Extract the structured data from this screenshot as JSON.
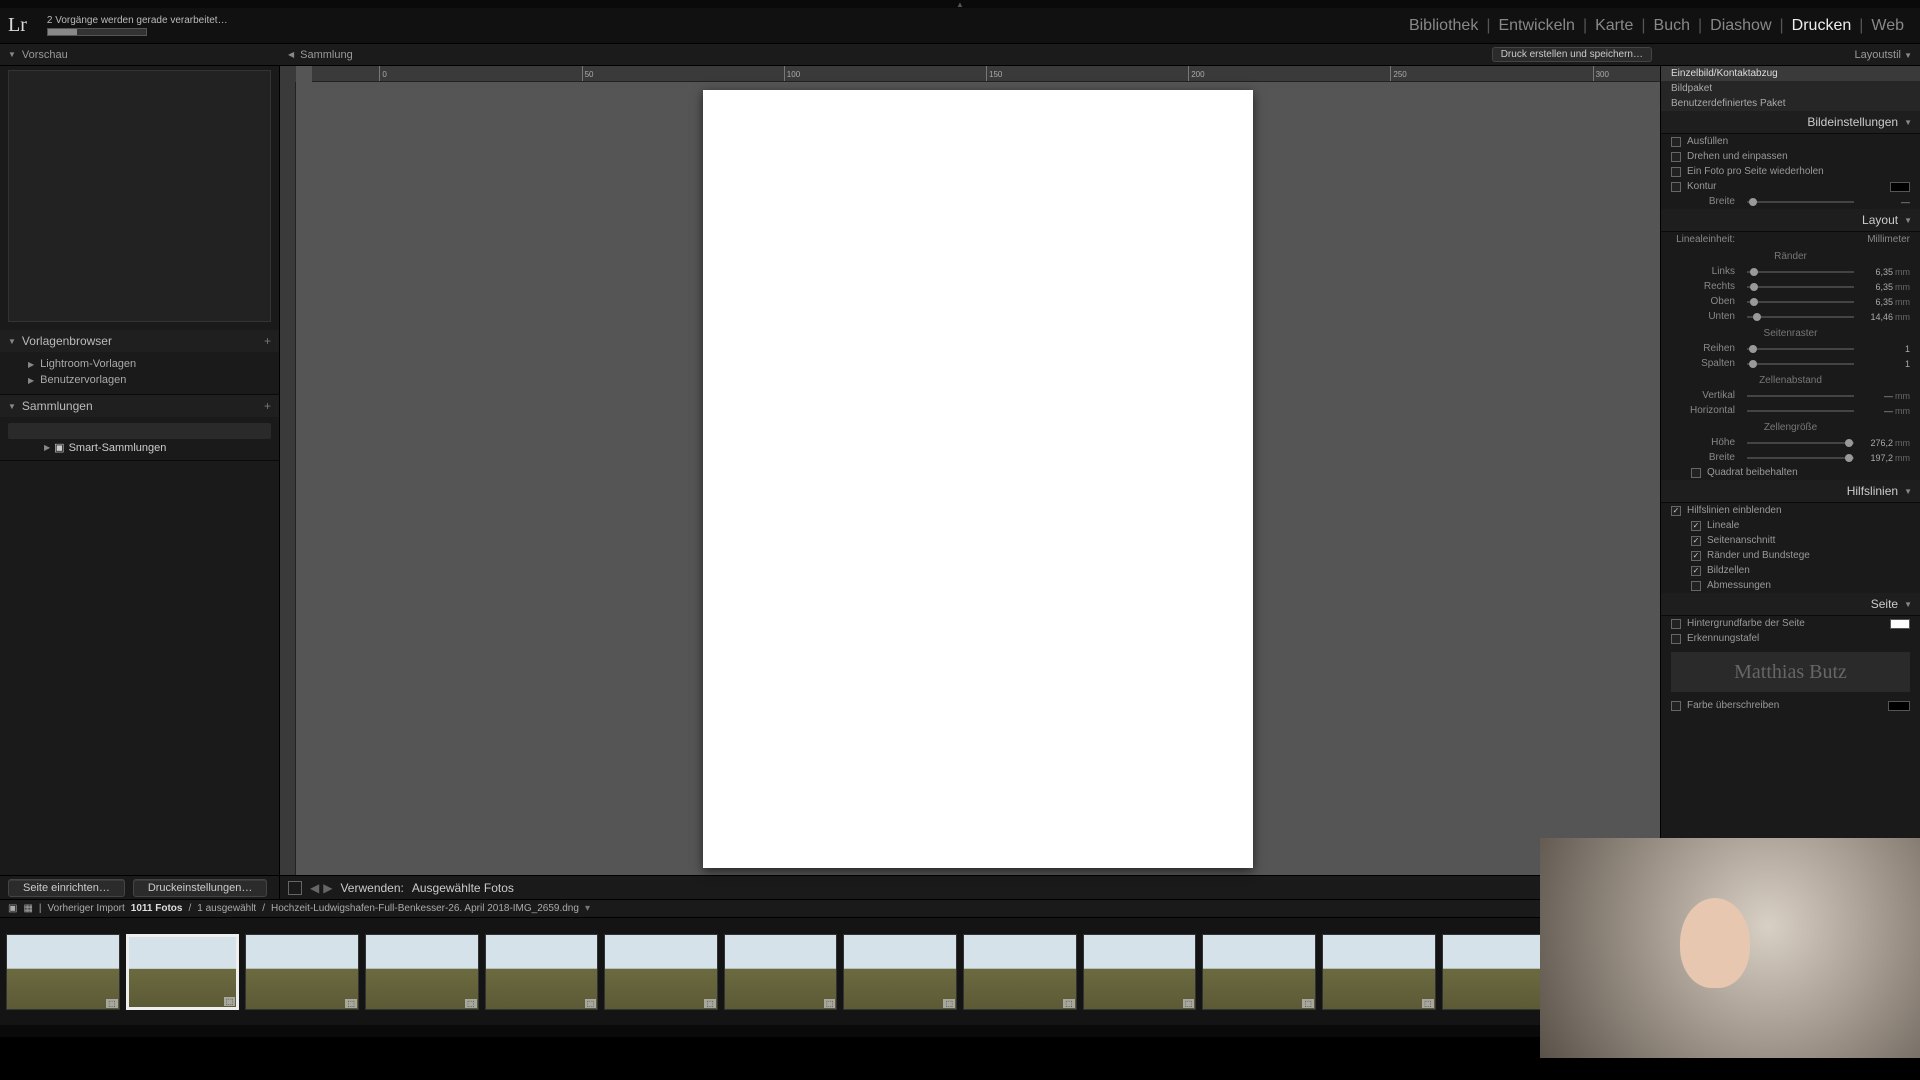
{
  "topbar": {
    "logo": "Lr",
    "progress_label": "2 Vorgänge werden gerade verarbeitet…",
    "top_caret": "▲"
  },
  "modules": {
    "items": [
      "Bibliothek",
      "Entwickeln",
      "Karte",
      "Buch",
      "Diashow",
      "Drucken",
      "Web"
    ],
    "active": "Drucken",
    "sep": "|"
  },
  "subbar": {
    "left_title": "Vorschau",
    "mid_title": "Sammlung",
    "print_button": "Druck erstellen und speichern…",
    "right_title": "Layoutstil"
  },
  "left": {
    "template_browser": "Vorlagenbrowser",
    "templates": [
      "Lightroom-Vorlagen",
      "Benutzervorlagen"
    ],
    "collections": "Sammlungen",
    "smart": "Smart-Sammlungen"
  },
  "left_buttons": {
    "page_setup": "Seite einrichten…",
    "print_settings": "Druckeinstellungen…"
  },
  "ruler_ticks": [
    "0",
    "50",
    "100",
    "150",
    "200",
    "250",
    "300"
  ],
  "right": {
    "style_list": [
      "Einzelbild/Kontaktabzug",
      "Bildpaket",
      "Benutzerdefiniertes Paket"
    ],
    "sections": {
      "image_settings": "Bildeinstellungen",
      "layout": "Layout",
      "guides": "Hilfslinien",
      "page": "Seite"
    },
    "img": {
      "zoom_fill": "Ausfüllen",
      "rotate_fit": "Drehen und einpassen",
      "repeat": "Ein Foto pro Seite wiederholen",
      "stroke": "Kontur",
      "width_label": "Breite"
    },
    "layout": {
      "unit_label": "Linealeinheit:",
      "unit_value": "Millimeter",
      "margins_title": "Ränder",
      "left": "Links",
      "right": "Rechts",
      "top": "Oben",
      "bottom": "Unten",
      "left_v": "6,35",
      "right_v": "6,35",
      "top_v": "6,35",
      "bottom_v": "14,46",
      "grid_title": "Seitenraster",
      "rows": "Reihen",
      "cols": "Spalten",
      "rows_v": "1",
      "cols_v": "1",
      "spacing_title": "Zellenabstand",
      "vert": "Vertikal",
      "horiz": "Horizontal",
      "cellsize_title": "Zellengröße",
      "height": "Höhe",
      "width": "Breite",
      "height_v": "276,2",
      "width_v": "197,2",
      "keep_square": "Quadrat beibehalten",
      "unit": "mm"
    },
    "guides": {
      "show": "Hilfslinien einblenden",
      "rulers": "Lineale",
      "bleed": "Seitenanschnitt",
      "margins": "Ränder und Bundstege",
      "cells": "Bildzellen",
      "dims": "Abmessungen"
    },
    "page": {
      "bg": "Hintergrundfarbe der Seite",
      "identity": "Erkennungstafel",
      "watermark_text": "Matthias Butz",
      "override_color": "Farbe überschreiben"
    }
  },
  "toolbar": {
    "use_label": "Verwenden:",
    "use_value": "Ausgewählte Fotos"
  },
  "info": {
    "prev_import": "Vorheriger Import",
    "count": "1011 Fotos",
    "sep": "/",
    "selected": "1 ausgewählt",
    "path": "Hochzeit-Ludwigshafen-Full-Benkesser-26. April 2018-IMG_2659.dng"
  },
  "filmstrip": {
    "count": 16
  }
}
